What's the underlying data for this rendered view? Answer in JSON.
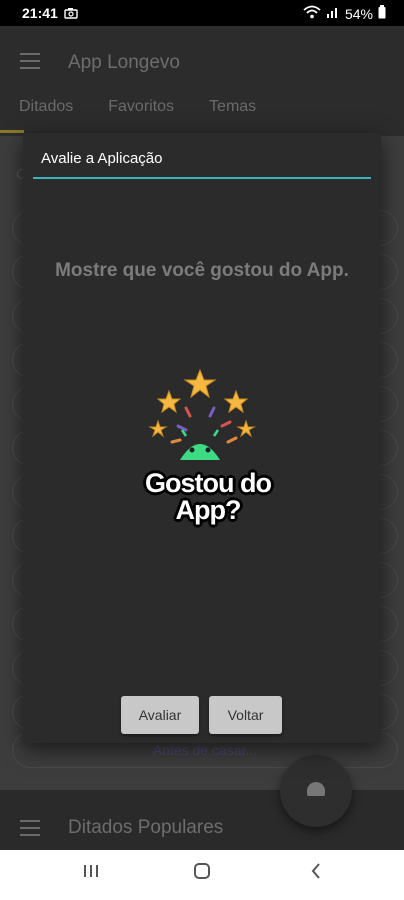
{
  "status_bar": {
    "time": "21:41",
    "battery": "54%"
  },
  "app_bar": {
    "title": "App Longevo"
  },
  "tabs": [
    {
      "label": "Ditados"
    },
    {
      "label": "Favoritos"
    },
    {
      "label": "Temas"
    }
  ],
  "list": {
    "partial_label": "C",
    "bottom_item": "Antes de casar..."
  },
  "bottom_bar": {
    "title": "Ditados Populares"
  },
  "dialog": {
    "title": "Avalie a Aplicação",
    "message": "Mostre que você gostou do App.",
    "art_caption_line1": "Gostou do",
    "art_caption_line2": "App?",
    "buttons": {
      "rate": "Avaliar",
      "back": "Voltar"
    }
  },
  "colors": {
    "accent_line": "#3fb1bd",
    "star": "#f5b942",
    "android": "#3ddc84"
  },
  "icons": [
    "menu-icon",
    "camera-icon",
    "wifi-icon",
    "signal-icon",
    "battery-icon",
    "android-icon",
    "star-icon",
    "recent-apps-icon",
    "home-icon",
    "back-icon"
  ]
}
